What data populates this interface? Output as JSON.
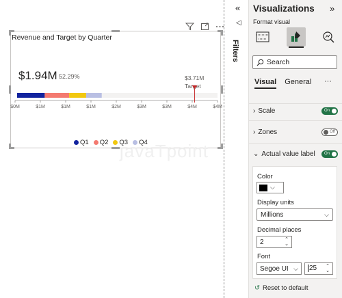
{
  "visual": {
    "title": "Revenue and Target by Quarter",
    "toolbar_icons": [
      "filter-icon",
      "focus-mode-icon",
      "more-options-icon"
    ],
    "big_value": "$1.94M",
    "percent": "52.29%",
    "target_value": "$3.71M",
    "target_label": "Target",
    "watermark": "javaTpoint"
  },
  "chart_data": {
    "type": "bar",
    "subtype": "bullet-gauge",
    "title": "Revenue and Target by Quarter",
    "axis_ticks": [
      "$0M",
      "$1M",
      "$1M",
      "$1M",
      "$2M",
      "$3M",
      "$3M",
      "$4M",
      "$4M"
    ],
    "axis_range": [
      0,
      4.5
    ],
    "series": [
      {
        "name": "Q1",
        "value": 0.62,
        "color": "#12239e"
      },
      {
        "name": "Q2",
        "value": 0.55,
        "color": "#f47a70"
      },
      {
        "name": "Q3",
        "value": 0.38,
        "color": "#f2c80f"
      },
      {
        "name": "Q4",
        "value": 0.35,
        "color": "#b9bfe3"
      }
    ],
    "total": 1.94,
    "percent_of_target": "52.29%",
    "target": 3.71,
    "target_color": "#c62828",
    "track_color": "#f3f2f1",
    "legend": [
      "Q1",
      "Q2",
      "Q3",
      "Q4"
    ],
    "legend_position": "bottom-center"
  },
  "filters": {
    "label": "Filters",
    "collapse_icon": "double-chevron-left-icon"
  },
  "pane": {
    "title": "Visualizations",
    "format_visual_label": "Format visual",
    "search_placeholder": "Search",
    "tabs": [
      "Visual",
      "General"
    ],
    "sections": [
      {
        "label": "Scale",
        "toggle": "On"
      },
      {
        "label": "Zones",
        "toggle": "Off"
      },
      {
        "label": "Actual value label",
        "toggle": "On"
      }
    ],
    "color_label": "Color",
    "color_value": "#000000",
    "display_units_label": "Display units",
    "display_units_value": "Millions",
    "decimal_label": "Decimal places",
    "decimal_value": "2",
    "font_label": "Font",
    "font_value": "Segoe UI",
    "font_size_value": "25",
    "reset_label": "Reset to default"
  }
}
